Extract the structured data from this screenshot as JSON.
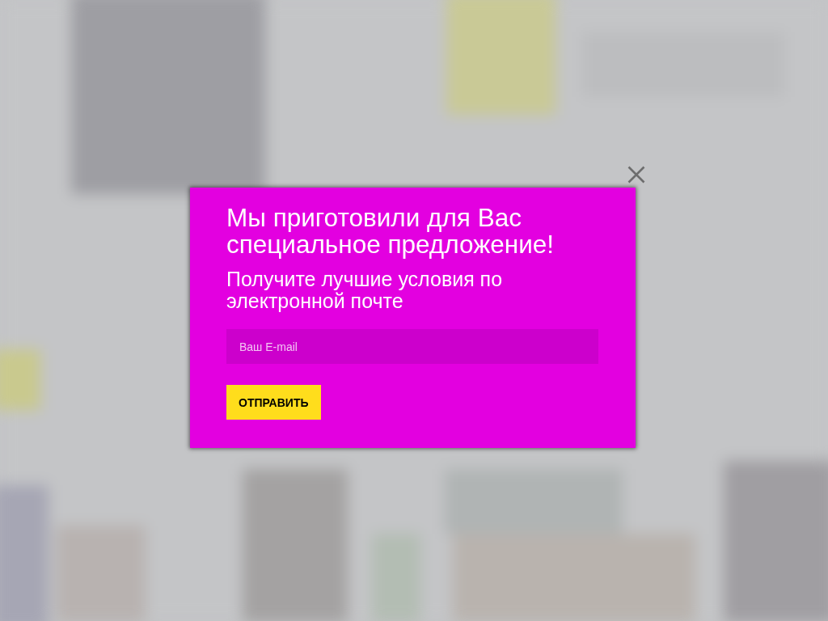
{
  "popup": {
    "title": "Мы приготовили для Вас специальное предложение!",
    "subtitle": "Получите лучшие условия по электронной почте",
    "email_field": {
      "placeholder": "Ваш E-mail"
    },
    "submit_button": {
      "label": "ОТПРАВИТЬ"
    }
  }
}
